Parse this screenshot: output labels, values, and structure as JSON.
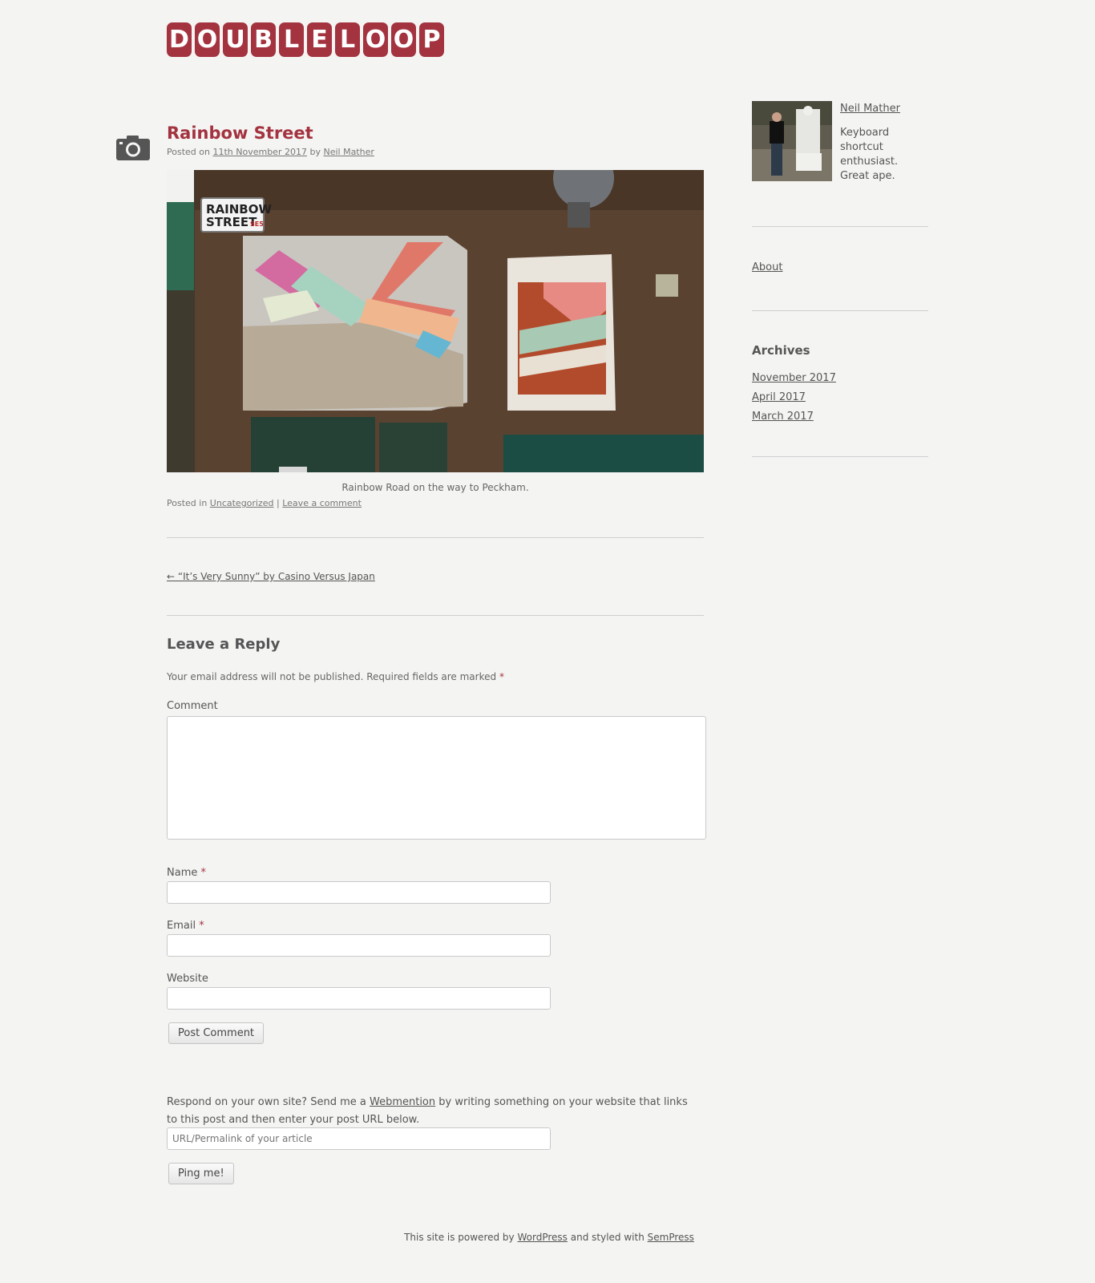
{
  "site": {
    "logo_letters": [
      "D",
      "O",
      "U",
      "B",
      "L",
      "E",
      "L",
      "O",
      "O",
      "P"
    ],
    "brand_color": "#a3333f"
  },
  "post": {
    "format_icon": "camera-icon",
    "title": "Rainbow Street",
    "posted_on_label": "Posted on",
    "date": "11th November 2017",
    "by_label": "by",
    "author": "Neil Mather",
    "image_alt": "Rainbow Street",
    "caption": "Rainbow Road on the way to Peckham.",
    "posted_in_label": "Posted in",
    "category": "Uncategorized",
    "separator": "|",
    "leave_comment": "Leave a comment"
  },
  "post_nav": {
    "previous": "← “It’s Very Sunny” by Casino Versus Japan"
  },
  "comment_form": {
    "title": "Leave a Reply",
    "notes": "Your email address will not be published. Required fields are marked",
    "required_mark": "*",
    "comment_label": "Comment",
    "name_label": "Name",
    "email_label": "Email",
    "website_label": "Website",
    "submit_label": "Post Comment"
  },
  "webmention": {
    "text_before": "Respond on your own site? Send me a",
    "link": "Webmention",
    "text_after": "by writing something on your website that links to this post and then enter your post URL below.",
    "placeholder": "URL/Permalink of your article",
    "submit_label": "Ping me!"
  },
  "sidebar": {
    "author_name": "Neil Mather",
    "author_bio": "Keyboard shortcut enthusiast. Great ape.",
    "pages": [
      "About"
    ],
    "archives_title": "Archives",
    "archives": [
      "November 2017",
      "April 2017",
      "March 2017"
    ]
  },
  "footer": {
    "powered_by": "This site is powered by",
    "wordpress": "WordPress",
    "styled_with": "and styled with",
    "theme": "SemPress"
  }
}
